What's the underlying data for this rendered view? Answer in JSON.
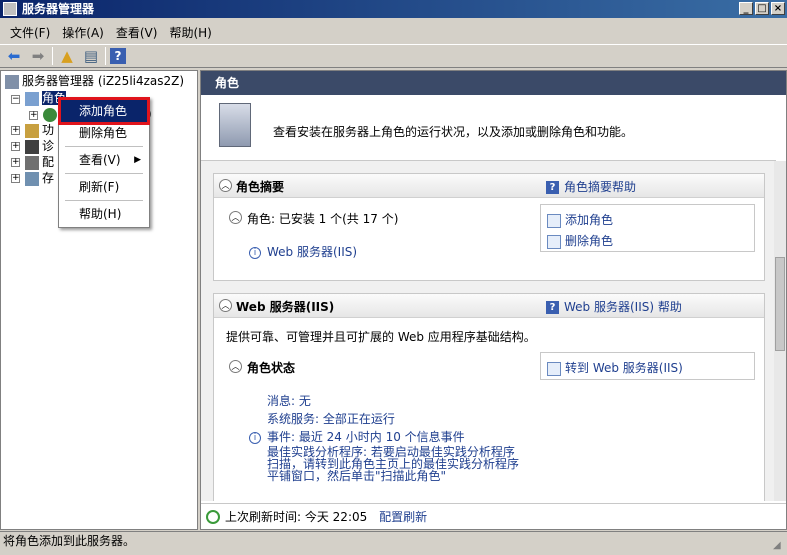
{
  "window": {
    "title": "服务器管理器"
  },
  "menu": [
    "文件(F)",
    "操作(A)",
    "查看(V)",
    "帮助(H)"
  ],
  "tree": {
    "root": "服务器管理器 (iZ25li4zas2Z)",
    "roles": "角色",
    "roles_child_suffix": ")",
    "features": "功",
    "diagnostics": "诊",
    "config": "配",
    "storage": "存"
  },
  "context_menu": {
    "add_role": "添加角色",
    "remove_role": "删除角色",
    "view": "查看(V)",
    "refresh": "刷新(F)",
    "help": "帮助(H)"
  },
  "right_pane": {
    "header": "角色",
    "banner_text": "查看安装在服务器上角色的运行状况，以及添加或删除角色和功能。",
    "summary": {
      "title": "角色摘要",
      "help_link": "角色摘要帮助",
      "roles_status": "角色: 已安装 1 个(共 17 个)",
      "installed_role": "Web 服务器(IIS)",
      "add_role": "添加角色",
      "remove_role": "删除角色"
    },
    "web": {
      "title": "Web 服务器(IIS)",
      "help_link": "Web 服务器(IIS) 帮助",
      "description": "提供可靠、可管理并且可扩展的 Web 应用程序基础结构。",
      "status_title": "角色状态",
      "goto_link": "转到 Web 服务器(IIS)",
      "messages": "消息: 无",
      "services": "系统服务: 全部正在运行",
      "events": "事件: 最近 24 小时内 10 个信息事件",
      "bpa_line1": "最佳实践分析程序: 若要启动最佳实践分析程序",
      "bpa_line2": "扫描，请转到此角色主页上的最佳实践分析程序",
      "bpa_line3": "平铺窗口，然后单击\"扫描此角色\""
    },
    "footer": {
      "refresh_label": "上次刷新时间: 今天 22:05",
      "config_link": "配置刷新"
    }
  },
  "statusbar": {
    "text": "将角色添加到此服务器。"
  }
}
